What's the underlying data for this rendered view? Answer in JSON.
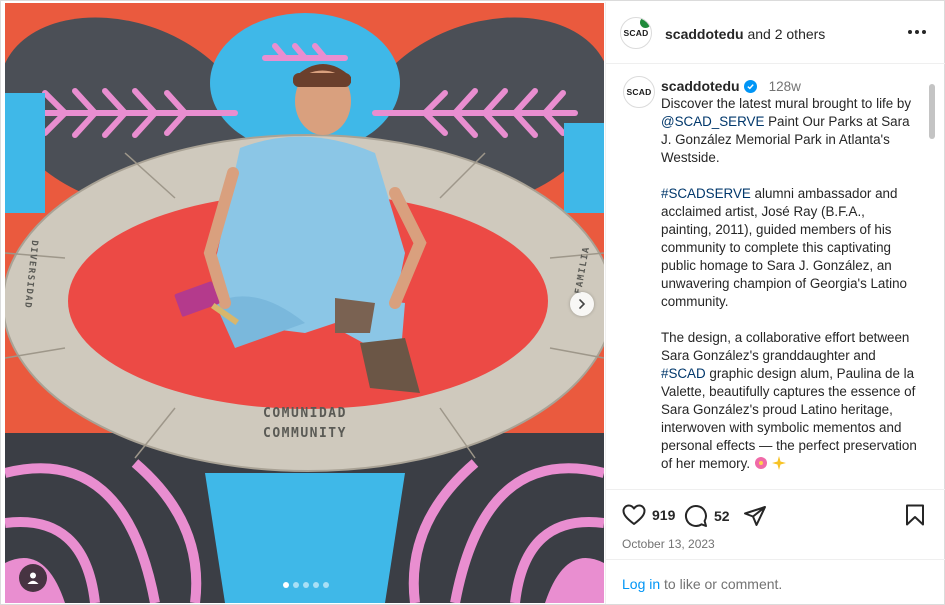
{
  "post": {
    "owner_username": "scaddotedu",
    "collab_text": "and 2 others",
    "avatar_text": "SCAD",
    "caption": {
      "username": "scaddotedu",
      "age": "128w",
      "p1_pre": "Discover the latest mural brought to life by ",
      "p1_mention": "@SCAD_SERVE",
      "p1_post": " Paint Our Parks at Sara J. González Memorial Park in Atlanta's Westside.",
      "p2_tag": "#SCADSERVE",
      "p2_post": " alumni ambassador and acclaimed artist, José Ray (B.F.A., painting, 2011), guided members of his community to complete this captivating public homage to Sara J. González, an unwavering champion of Georgia's Latino community.",
      "p3_pre": "The design, a collaborative effort between Sara González's granddaughter and ",
      "p3_tag": "#SCAD",
      "p3_post": " graphic design alum, Paulina de la Valette, beautifully captures the essence of Sara González's proud Latino heritage, interwoven with symbolic mementos and personal effects — the perfect preservation of her memory."
    },
    "likes": "919",
    "comments": "52",
    "date": "October 13, 2023",
    "carousel": {
      "current": 1,
      "total": 5
    },
    "mural_text": {
      "line1": "COMUNIDAD",
      "line2": "COMMUNITY",
      "left_side": "DIVERSIDAD",
      "right_side": "FAMILIA"
    }
  },
  "login": {
    "link_text": "Log in",
    "rest_text": " to like or comment."
  },
  "icons": {
    "more": "more-dots-icon",
    "like": "heart-icon",
    "comment": "comment-bubble-icon",
    "share": "paper-plane-icon",
    "save": "bookmark-icon",
    "next": "chevron-right-icon",
    "tag": "user-tag-icon",
    "verified": "verified-badge-icon"
  },
  "colors": {
    "link": "#00376b",
    "accent": "#0095f6",
    "muted": "#737373"
  }
}
